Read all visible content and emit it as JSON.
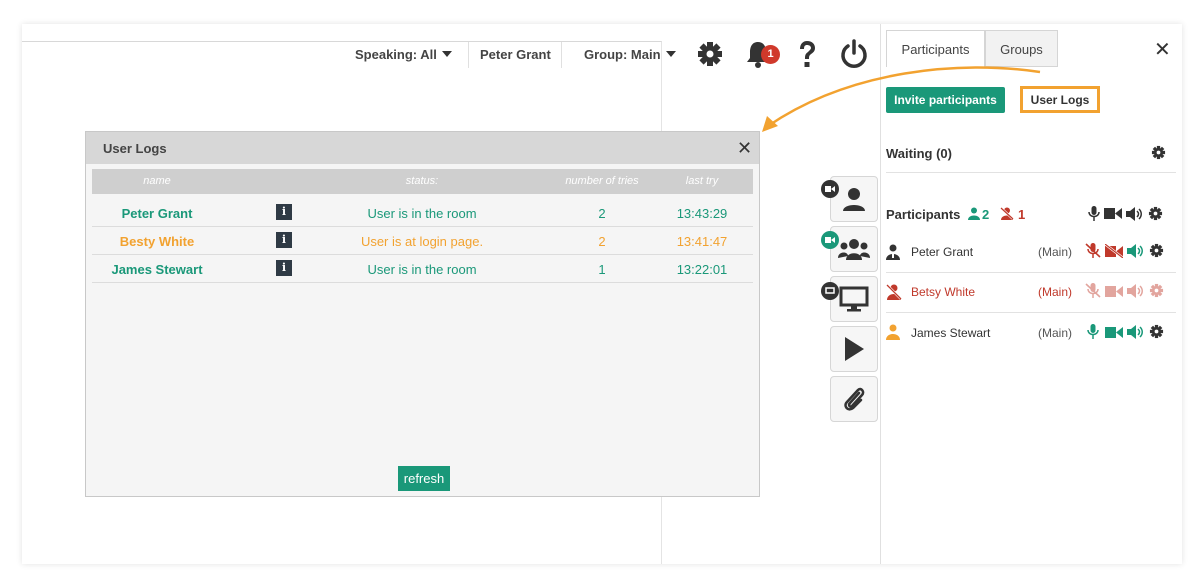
{
  "topbar": {
    "speaking_label": "Speaking: All",
    "user_label": "Peter Grant",
    "group_label": "Group: Main",
    "notification_count": "1"
  },
  "icons": {
    "settings": "gear-icon",
    "notifications": "bell-icon",
    "help": "question-icon",
    "power": "power-icon"
  },
  "panel": {
    "tabs": [
      {
        "label": "Participants",
        "active": true
      },
      {
        "label": "Groups",
        "active": false
      }
    ],
    "invite_label": "Invite participants",
    "user_logs_label": "User Logs",
    "waiting_label": "Waiting (0)",
    "participants_label": "Participants",
    "online_count": "2",
    "offline_count": "1",
    "participants": [
      {
        "name": "Peter Grant",
        "group": "(Main)",
        "status": "online-host"
      },
      {
        "name": "Betsy White",
        "group": "(Main)",
        "status": "offline"
      },
      {
        "name": "James Stewart",
        "group": "(Main)",
        "status": "online"
      }
    ]
  },
  "dialog": {
    "title": "User Logs",
    "columns": [
      "name",
      "status:",
      "number of tries",
      "last try"
    ],
    "rows": [
      {
        "name": "Peter Grant",
        "status": "User is in the room",
        "tries": "2",
        "last_try": "13:43:29",
        "tone": "green"
      },
      {
        "name": "Besty White",
        "status": "User is at login page.",
        "tries": "2",
        "last_try": "13:41:47",
        "tone": "orange"
      },
      {
        "name": "James Stewart",
        "status": "User is in the room",
        "tries": "1",
        "last_try": "13:22:01",
        "tone": "green"
      }
    ],
    "refresh_label": "refresh"
  },
  "colors": {
    "accent_green": "#1a9879",
    "highlight_orange": "#f2a230",
    "alert_red": "#c0392b"
  }
}
